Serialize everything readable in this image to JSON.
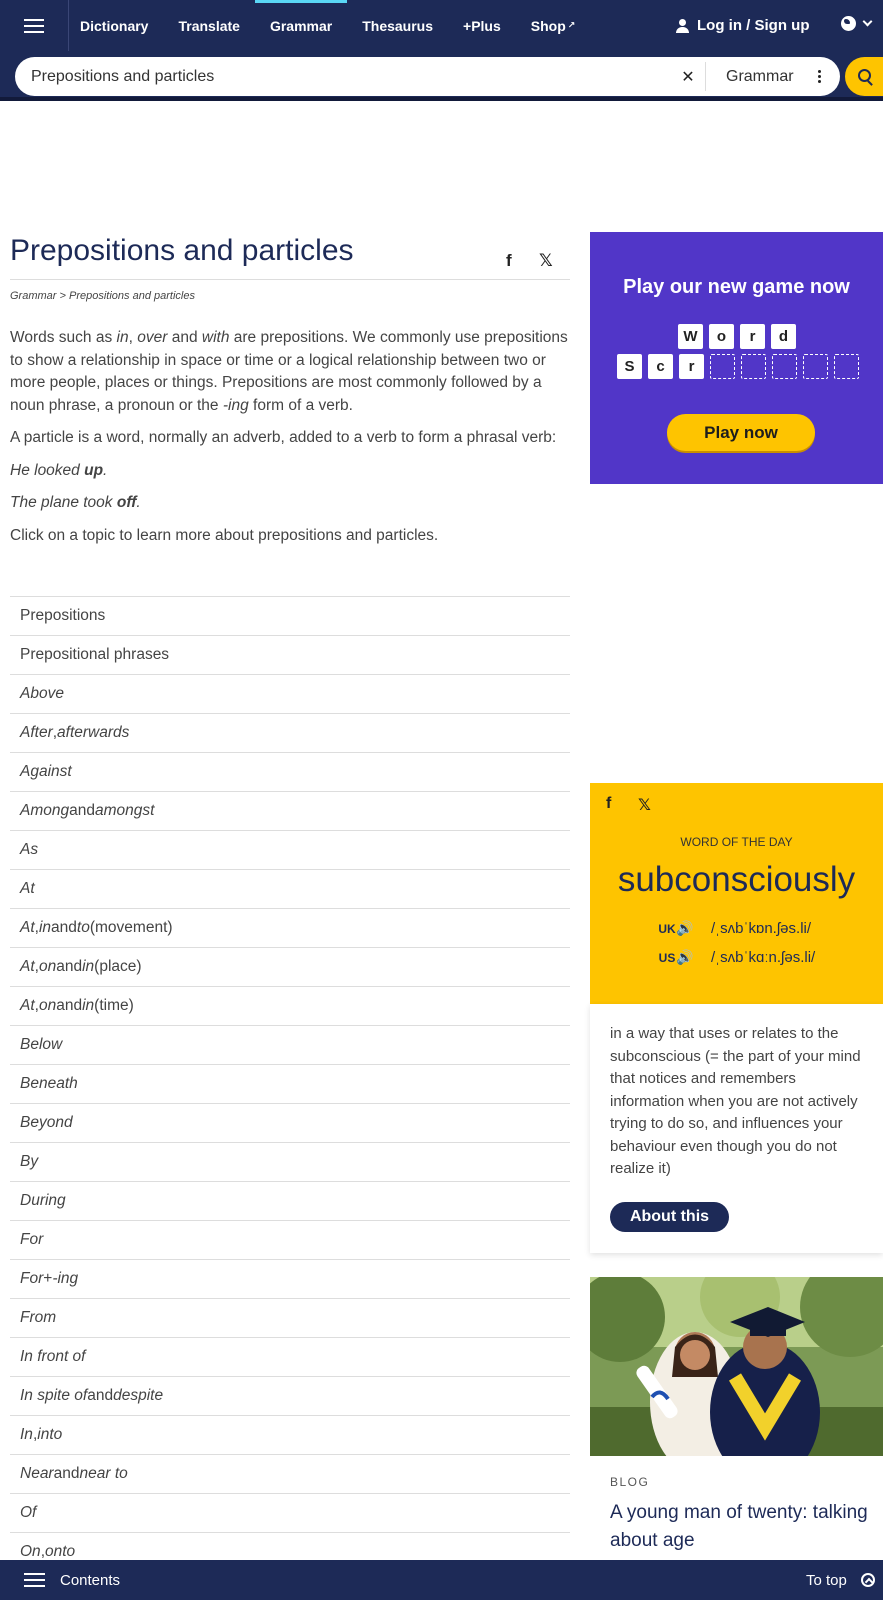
{
  "nav": {
    "links": [
      "Dictionary",
      "Translate",
      "Grammar",
      "Thesaurus",
      "+Plus",
      "Shop"
    ],
    "active": "Grammar",
    "login": "Log in / Sign up"
  },
  "search": {
    "value": "Prepositions and particles",
    "dictionary": "Grammar"
  },
  "page": {
    "title": "Prepositions and particles",
    "breadcrumb_root": "Grammar",
    "breadcrumb_sep": " > ",
    "breadcrumb_current": "Prepositions and particles"
  },
  "intro": {
    "p1_a": "Words such as ",
    "p1_in": "in",
    "p1_b": ", ",
    "p1_over": "over",
    "p1_c": " and ",
    "p1_with": "with",
    "p1_d": " are prepositions. We commonly use prepositions to show a relationship in space or time or a logical relationship between two or more people, places or things. Prepositions are most commonly followed by a noun phrase, a pronoun or the ",
    "p1_ing": "-ing",
    "p1_e": " form of a verb.",
    "p2": "A particle is a word, normally an adverb, added to a verb to form a phrasal verb:",
    "ex1_a": "He looked ",
    "ex1_b": "up",
    "ex1_c": ".",
    "ex2_a": "The plane took ",
    "ex2_b": "off",
    "ex2_c": ".",
    "p3": "Click on a topic to learn more about prepositions and particles."
  },
  "topics": [
    [
      {
        "t": "Prepositions",
        "i": false
      }
    ],
    [
      {
        "t": "Prepositional phrases",
        "i": false
      }
    ],
    [
      {
        "t": "Above",
        "i": true
      }
    ],
    [
      {
        "t": "After",
        "i": true
      },
      {
        "t": ", ",
        "i": false
      },
      {
        "t": "afterwards",
        "i": true
      }
    ],
    [
      {
        "t": "Against",
        "i": true
      }
    ],
    [
      {
        "t": "Among",
        "i": true
      },
      {
        "t": " and ",
        "i": false
      },
      {
        "t": "amongst",
        "i": true
      }
    ],
    [
      {
        "t": "As",
        "i": true
      }
    ],
    [
      {
        "t": "At",
        "i": true
      }
    ],
    [
      {
        "t": "At",
        "i": true
      },
      {
        "t": ", ",
        "i": false
      },
      {
        "t": "in",
        "i": true
      },
      {
        "t": " and ",
        "i": false
      },
      {
        "t": "to",
        "i": true
      },
      {
        "t": " (movement)",
        "i": false
      }
    ],
    [
      {
        "t": "At",
        "i": true
      },
      {
        "t": ", ",
        "i": false
      },
      {
        "t": "on",
        "i": true
      },
      {
        "t": " and ",
        "i": false
      },
      {
        "t": "in",
        "i": true
      },
      {
        "t": " (place)",
        "i": false
      }
    ],
    [
      {
        "t": "At",
        "i": true
      },
      {
        "t": ", ",
        "i": false
      },
      {
        "t": "on",
        "i": true
      },
      {
        "t": " and ",
        "i": false
      },
      {
        "t": "in",
        "i": true
      },
      {
        "t": " (time)",
        "i": false
      }
    ],
    [
      {
        "t": "Below",
        "i": true
      }
    ],
    [
      {
        "t": "Beneath",
        "i": true
      }
    ],
    [
      {
        "t": "Beyond",
        "i": true
      }
    ],
    [
      {
        "t": "By",
        "i": true
      }
    ],
    [
      {
        "t": "During",
        "i": true
      }
    ],
    [
      {
        "t": "For",
        "i": true
      }
    ],
    [
      {
        "t": "For",
        "i": true
      },
      {
        "t": " + ",
        "i": false
      },
      {
        "t": "-ing",
        "i": true
      }
    ],
    [
      {
        "t": "From",
        "i": true
      }
    ],
    [
      {
        "t": "In front of",
        "i": true
      }
    ],
    [
      {
        "t": "In spite of",
        "i": true
      },
      {
        "t": " and ",
        "i": false
      },
      {
        "t": "despite",
        "i": true
      }
    ],
    [
      {
        "t": "In",
        "i": true
      },
      {
        "t": ", ",
        "i": false
      },
      {
        "t": "into",
        "i": true
      }
    ],
    [
      {
        "t": "Near",
        "i": true
      },
      {
        "t": " and ",
        "i": false
      },
      {
        "t": "near to",
        "i": true
      }
    ],
    [
      {
        "t": "Of",
        "i": true
      }
    ],
    [
      {
        "t": "On",
        "i": true
      },
      {
        "t": ", ",
        "i": false
      },
      {
        "t": "onto",
        "i": true
      }
    ]
  ],
  "game_ad": {
    "title": "Play our new game now",
    "tiles_row1": [
      "W",
      "o",
      "r",
      "d"
    ],
    "tiles_row2": [
      "S",
      "c",
      "r"
    ],
    "button": "Play now",
    "bg_color": "#5136c8"
  },
  "wotd": {
    "label": "WORD OF THE DAY",
    "word": "subconsciously",
    "uk_label": "UK",
    "uk_ipa": "/ˌsʌbˈkɒn.ʃəs.li/",
    "us_label": "US",
    "us_ipa": "/ˌsʌbˈkɑːn.ʃəs.li/",
    "definition": "in a way that uses or relates to the subconscious (= the part of your mind that notices and remembers information when you are not actively trying to do so, and influences your behaviour even though you do not realize it)",
    "button": "About this",
    "bg_color": "#fec400"
  },
  "blog": {
    "label": "BLOG",
    "title": "A young man of twenty: talking about age"
  },
  "bottom": {
    "contents": "Contents",
    "to_top": "To top"
  },
  "colors": {
    "navy": "#1d2a57",
    "yellow": "#fec400",
    "active_underline": "#5ad7f5"
  },
  "icons": [
    "menu-icon",
    "external-link-icon",
    "user-icon",
    "globe-icon",
    "chevron-down-icon",
    "clear-icon",
    "more-icon",
    "search-icon",
    "facebook-icon",
    "x-icon",
    "speaker-icon",
    "to-top-icon"
  ]
}
